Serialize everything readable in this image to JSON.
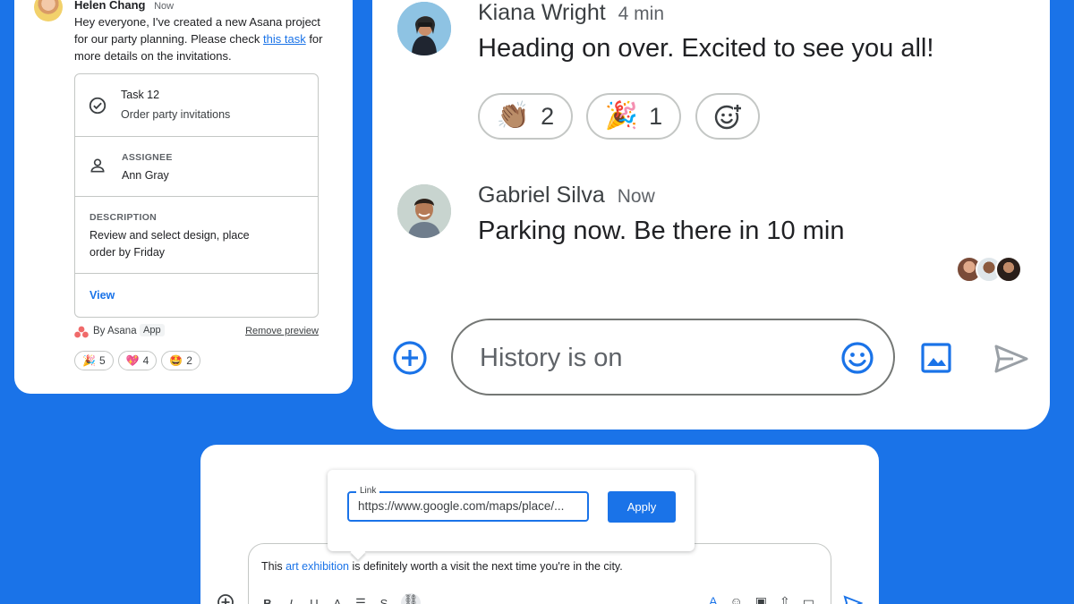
{
  "asana_card": {
    "sender_name": "Helen Chang",
    "sender_time": "Now",
    "message_before_link": "Hey everyone, I've created a new Asana project for our party planning.  Please check ",
    "message_link": "this task",
    "message_after_link": " for more details on the invitations.",
    "task": {
      "number": "Task 12",
      "title": "Order party invitations",
      "assignee_label": "ASSIGNEE",
      "assignee": "Ann Gray",
      "description_label": "DESCRIPTION",
      "description_line1": "Review and select design, place",
      "description_line2": "order by Friday",
      "view_label": "View"
    },
    "by_text": "By Asana",
    "app_tag": "App",
    "remove_preview": "Remove preview",
    "reactions": [
      {
        "emoji": "🎉",
        "count": "5"
      },
      {
        "emoji": "💖",
        "count": "4"
      },
      {
        "emoji": "🤩",
        "count": "2"
      }
    ]
  },
  "chat": {
    "messages": [
      {
        "name": "Kiana Wright",
        "time": "4 min",
        "text": "Heading on over. Excited to see you all!"
      },
      {
        "name": "Gabriel Silva",
        "time": "Now",
        "text": "Parking now.  Be there in 10 min"
      }
    ],
    "reactions": [
      {
        "emoji": "👏🏽",
        "count": "2"
      },
      {
        "emoji": "🎉",
        "count": "1"
      }
    ],
    "compose_placeholder": "History is on"
  },
  "link_editor": {
    "field_label": "Link",
    "field_value": "https://www.google.com/maps/place/...",
    "apply_label": "Apply",
    "text_before": "This ",
    "text_link": "art exhibition",
    "text_after": " is definitely worth a visit the next time you're in the city.",
    "format_buttons": [
      "B",
      "I",
      "U",
      "A"
    ]
  },
  "colors": {
    "background": "#1a73e8",
    "accent": "#1a73e8",
    "border": "#c4c7c5"
  }
}
